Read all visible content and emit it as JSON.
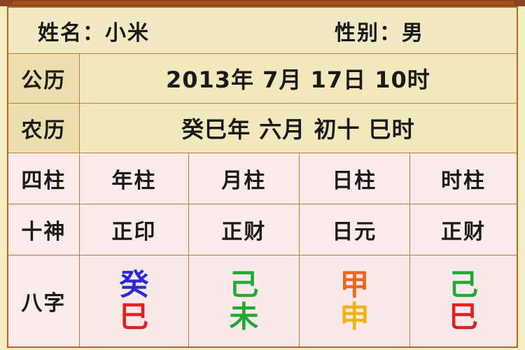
{
  "header": {
    "name_label": "姓名：小米",
    "gender_label": "性别：男"
  },
  "calendar": {
    "solar_label": "公历",
    "solar_value": "2013年 7月 17日 10时",
    "lunar_label": "农历",
    "lunar_value": "癸巳年 六月 初十 巳时"
  },
  "pillars": {
    "row_label": "四柱",
    "columns": [
      {
        "label": "年柱"
      },
      {
        "label": "月柱"
      },
      {
        "label": "日柱"
      },
      {
        "label": "时柱"
      }
    ]
  },
  "ten_gods": {
    "row_label": "十神",
    "values": [
      "正印",
      "正财",
      "日元",
      "正财"
    ]
  },
  "bazi": {
    "row_label": "八字",
    "columns": [
      {
        "stem": "癸",
        "stem_color": "#2a2ad8",
        "branch": "巳",
        "branch_color": "#e02020"
      },
      {
        "stem": "己",
        "stem_color": "#1faa35",
        "branch": "未",
        "branch_color": "#1faa35"
      },
      {
        "stem": "甲",
        "stem_color": "#ef6520",
        "branch": "申",
        "branch_color": "#efb315"
      },
      {
        "stem": "己",
        "stem_color": "#1faa35",
        "branch": "巳",
        "branch_color": "#e02020"
      }
    ]
  },
  "theme": {
    "border_color": "#b5681f",
    "grid_color": "#c07c34",
    "beige_bg": "#ecdfae",
    "beige_light_bg": "#f2e7bd",
    "pink_bg": "#fbe9e9",
    "top_band_color": "#8a4520"
  }
}
